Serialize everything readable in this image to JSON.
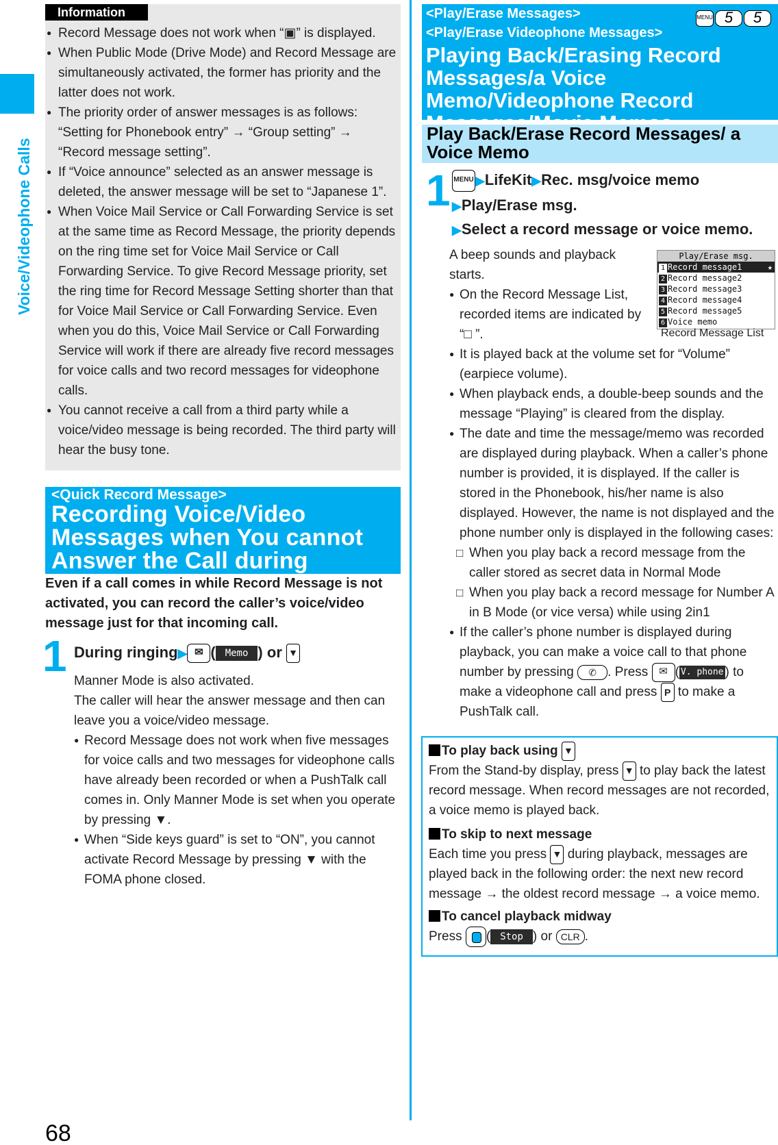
{
  "side_tab": {
    "label": "Voice/Videophone Calls",
    "color": "#00aeef"
  },
  "page_number": "68",
  "information": {
    "tag": "Information",
    "items": [
      "Record Message does not work when “▣” is displayed.",
      "When Public Mode (Drive Mode) and Record Message are simultaneously activated, the former has priority and the latter does not work.",
      "The priority order of answer messages is as follows: “Setting for Phonebook entry” → “Group setting” → “Record message setting”.",
      "If “Voice announce” selected as an answer message is deleted, the answer message will be set to “Japanese 1”.",
      "When Voice Mail Service or Call Forwarding Service is set at the same time as Record Message, the priority depends on the ring time set for Voice Mail Service or Call Forwarding Service. To give Record Message priority, set the ring time for Record Message Setting shorter than that for Voice Mail Service or Call Forwarding Service. Even when you do this, Voice Mail Service or Call Forwarding Service will work if there are already five record messages for voice calls and two record messages for videophone calls.",
      "You cannot receive a call from a third party while a voice/video message is being recorded. The third party will hear the busy tone."
    ]
  },
  "quick_record": {
    "tag": "<Quick Record Message>",
    "title": "Recording Voice/Video Messages when You cannot Answer the Call during Ringing",
    "lead": "Even if a call comes in while Record Message is not activated, you can record the caller’s voice/video message just for that incoming call.",
    "step": {
      "number": "1",
      "label": "During ringing",
      "softkey": "Memo",
      "or": "or",
      "paras": [
        "Manner Mode is also activated.",
        "The caller will hear the answer message and then can leave you a voice/video message."
      ],
      "bullets": [
        "Record Message does not work when five messages for voice calls and two messages for videophone calls have already been recorded or when a PushTalk call comes in. Only Manner Mode is set when you operate by pressing ▼.",
        "When “Side keys guard” is set to “ON”, you cannot activate Record Message by pressing ▼ with the FOMA phone closed."
      ]
    }
  },
  "play_erase": {
    "tag1": "<Play/Erase Messages>",
    "tag2": "<Play/Erase Videophone Messages>",
    "title": "Playing Back/Erasing Record Messages/a Voice Memo/Videophone Record Messages/Movie Memos",
    "menu_keys": [
      "MENU",
      "5",
      "5"
    ],
    "subhead": "Play Back/Erase Record Messages/ a Voice Memo",
    "step": {
      "number": "1",
      "menu_key": "MENU",
      "path1": "LifeKit",
      "path2": "Rec. msg/voice memo",
      "path3": "Play/Erase msg.",
      "path4": "Select a record message or voice memo.",
      "intro": "A beep sounds and playback starts.",
      "bullet_list_icon": "On the Record Message List, recorded items are indicated by “□ ”.",
      "bullets": [
        "It is played back at the volume set for “Volume” (earpiece volume).",
        "When playback ends, a double-beep sounds and the message “Playing” is cleared from the display.",
        "The date and time the message/memo was recorded are displayed during playback. When a caller’s phone number is provided, it is displayed. If the caller is stored in the Phonebook, his/her name is also displayed. However, the name is not displayed and the phone number only is displayed in the following cases:"
      ],
      "sub_items": [
        "When you play back a record message from the caller stored as secret data in Normal Mode",
        "When you play back a record message for Number A in B Mode (or vice versa) while using 2in1"
      ],
      "last_bullet": {
        "a": "If the caller’s phone number is displayed during playback, you can make a voice call to that phone number by pressing",
        "b": ". Press",
        "softkey": "V. phone",
        "c": ") to make a videophone call and press",
        "d": "to make a PushTalk call."
      }
    },
    "screen": {
      "title": "Play/Erase msg.",
      "rows": [
        {
          "n": "1",
          "label": "Record message1",
          "selected": true,
          "star": "★"
        },
        {
          "n": "2",
          "label": "Record message2"
        },
        {
          "n": "3",
          "label": "Record message3"
        },
        {
          "n": "4",
          "label": "Record message4"
        },
        {
          "n": "5",
          "label": "Record message5"
        },
        {
          "n": "6",
          "label": "Voice memo"
        }
      ],
      "caption": "Record Message List"
    }
  },
  "tips": [
    {
      "head": "To play back using",
      "text_a": "From the Stand-by display, press",
      "text_b": "to play back the latest record message. When record messages are not recorded, a voice memo is played back."
    },
    {
      "head": "To skip to next message",
      "text_a": "Each time you press",
      "text_b": "during playback, messages are played back in the following order: the next new record message → the oldest record message → a voice memo."
    },
    {
      "head": "To cancel playback midway",
      "text_a": "Press",
      "softkey": "Stop",
      "text_b": ") or",
      "clr": "CLR"
    }
  ]
}
